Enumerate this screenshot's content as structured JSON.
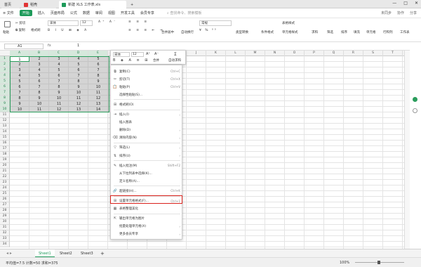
{
  "tabs": {
    "home": "首页",
    "wps": "稻壳",
    "file": "新建 XLS 工作表.xls",
    "add": "+"
  },
  "window": {
    "min": "—",
    "max": "□",
    "close": "✕"
  },
  "menubar": {
    "file_menu": "≡ 文件",
    "items": [
      "开始",
      "插入",
      "页面布局",
      "公式",
      "数据",
      "审阅",
      "视图",
      "开发工具",
      "会员专享"
    ],
    "search": "查找命令、搜索模板",
    "right": [
      "未同步",
      "协作",
      "分享"
    ]
  },
  "ribbon": {
    "paste": "粘贴",
    "cut": "剪切",
    "copy": "复制",
    "format_painter": "格式刷",
    "font": "宋体",
    "size": "12",
    "merge": "合并居中",
    "wrap": "自动换行",
    "numfmt": "常规",
    "convert": "类型转换",
    "cond": "条件格式",
    "table_style": "表格样式",
    "cell_style": "单元格样式",
    "sum": "求和",
    "filter": "筛选",
    "sort": "排序",
    "fill": "填充",
    "cell": "单元格",
    "rowcol": "行和列",
    "sheet": "工作表"
  },
  "formula": {
    "namebox": "A1",
    "fx": "fx",
    "value": "1"
  },
  "columns": [
    "A",
    "B",
    "C",
    "D",
    "E",
    "F",
    "G",
    "H",
    "I",
    "J",
    "K",
    "L",
    "M",
    "N",
    "O",
    "P",
    "Q",
    "R",
    "S",
    "T",
    "U",
    "V",
    "W"
  ],
  "rows": [
    "1",
    "2",
    "3",
    "4",
    "5",
    "6",
    "7",
    "8",
    "9",
    "10",
    "11",
    "12",
    "13",
    "14",
    "15",
    "16",
    "17",
    "18",
    "19",
    "20",
    "21",
    "22",
    "23",
    "24",
    "25",
    "26",
    "27",
    "28",
    "29",
    "30",
    "31",
    "32",
    "33",
    "34"
  ],
  "cells": [
    [
      "1",
      "2",
      "3",
      "4",
      "5"
    ],
    [
      "2",
      "3",
      "4",
      "5",
      "6"
    ],
    [
      "3",
      "4",
      "5",
      "6",
      "7"
    ],
    [
      "4",
      "5",
      "6",
      "7",
      "8"
    ],
    [
      "5",
      "6",
      "7",
      "8",
      "9"
    ],
    [
      "6",
      "7",
      "8",
      "9",
      "10"
    ],
    [
      "7",
      "8",
      "9",
      "10",
      "11"
    ],
    [
      "8",
      "9",
      "10",
      "11",
      "12"
    ],
    [
      "9",
      "10",
      "11",
      "12",
      "13"
    ],
    [
      "10",
      "11",
      "12",
      "13",
      "14"
    ]
  ],
  "mini_toolbar": {
    "font": "宋体",
    "size": "12",
    "font_up": "A⁺",
    "font_down": "A⁻",
    "merge": "合并",
    "autosum": "自动求和"
  },
  "context_menu": [
    {
      "icon": "⧉",
      "label": "复制(C)",
      "shortcut": "Ctrl+C"
    },
    {
      "icon": "✂",
      "label": "剪切(T)",
      "shortcut": "Ctrl+X"
    },
    {
      "icon": "📋",
      "label": "粘贴(P)",
      "shortcut": "Ctrl+V"
    },
    {
      "icon": "",
      "label": "选择性粘贴(S)...",
      "shortcut": ""
    },
    {
      "icon": "⊞",
      "label": "格式刷(O)",
      "shortcut": ""
    },
    {
      "icon": "⇥",
      "label": "插入(I)",
      "shortcut": "›"
    },
    {
      "icon": "",
      "label": "插入图表",
      "shortcut": ""
    },
    {
      "icon": "",
      "label": "删除(D)",
      "shortcut": "›"
    },
    {
      "icon": "⌫",
      "label": "清除内容(N)",
      "shortcut": "›"
    },
    {
      "icon": "▽",
      "label": "筛选(L)",
      "shortcut": "›"
    },
    {
      "icon": "⇅",
      "label": "排序(U)",
      "shortcut": "›"
    },
    {
      "icon": "✎",
      "label": "插入批注(M)",
      "shortcut": "Shift+F2"
    },
    {
      "icon": "",
      "label": "从下拉列表中选择(K)...",
      "shortcut": ""
    },
    {
      "icon": "",
      "label": "定义名称(A)...",
      "shortcut": ""
    },
    {
      "icon": "🔗",
      "label": "超链接(H)...",
      "shortcut": "Ctrl+K"
    },
    {
      "icon": "⊞",
      "label": "设置单元格格式(F)...",
      "shortcut": "Ctrl+1"
    },
    {
      "icon": "▦",
      "label": "表格整理美化",
      "shortcut": ""
    },
    {
      "icon": "⇱",
      "label": "输出单元格为图片",
      "shortcut": ""
    },
    {
      "icon": "",
      "label": "批量处理单元格(X)",
      "shortcut": "›"
    },
    {
      "icon": "",
      "label": "更多会员专享",
      "shortcut": "›"
    }
  ],
  "sheets": [
    "Sheet1",
    "Sheet2",
    "Sheet3"
  ],
  "status": {
    "summary": "平均值=7.5  计数=50  求和=375",
    "zoom": "100%"
  }
}
